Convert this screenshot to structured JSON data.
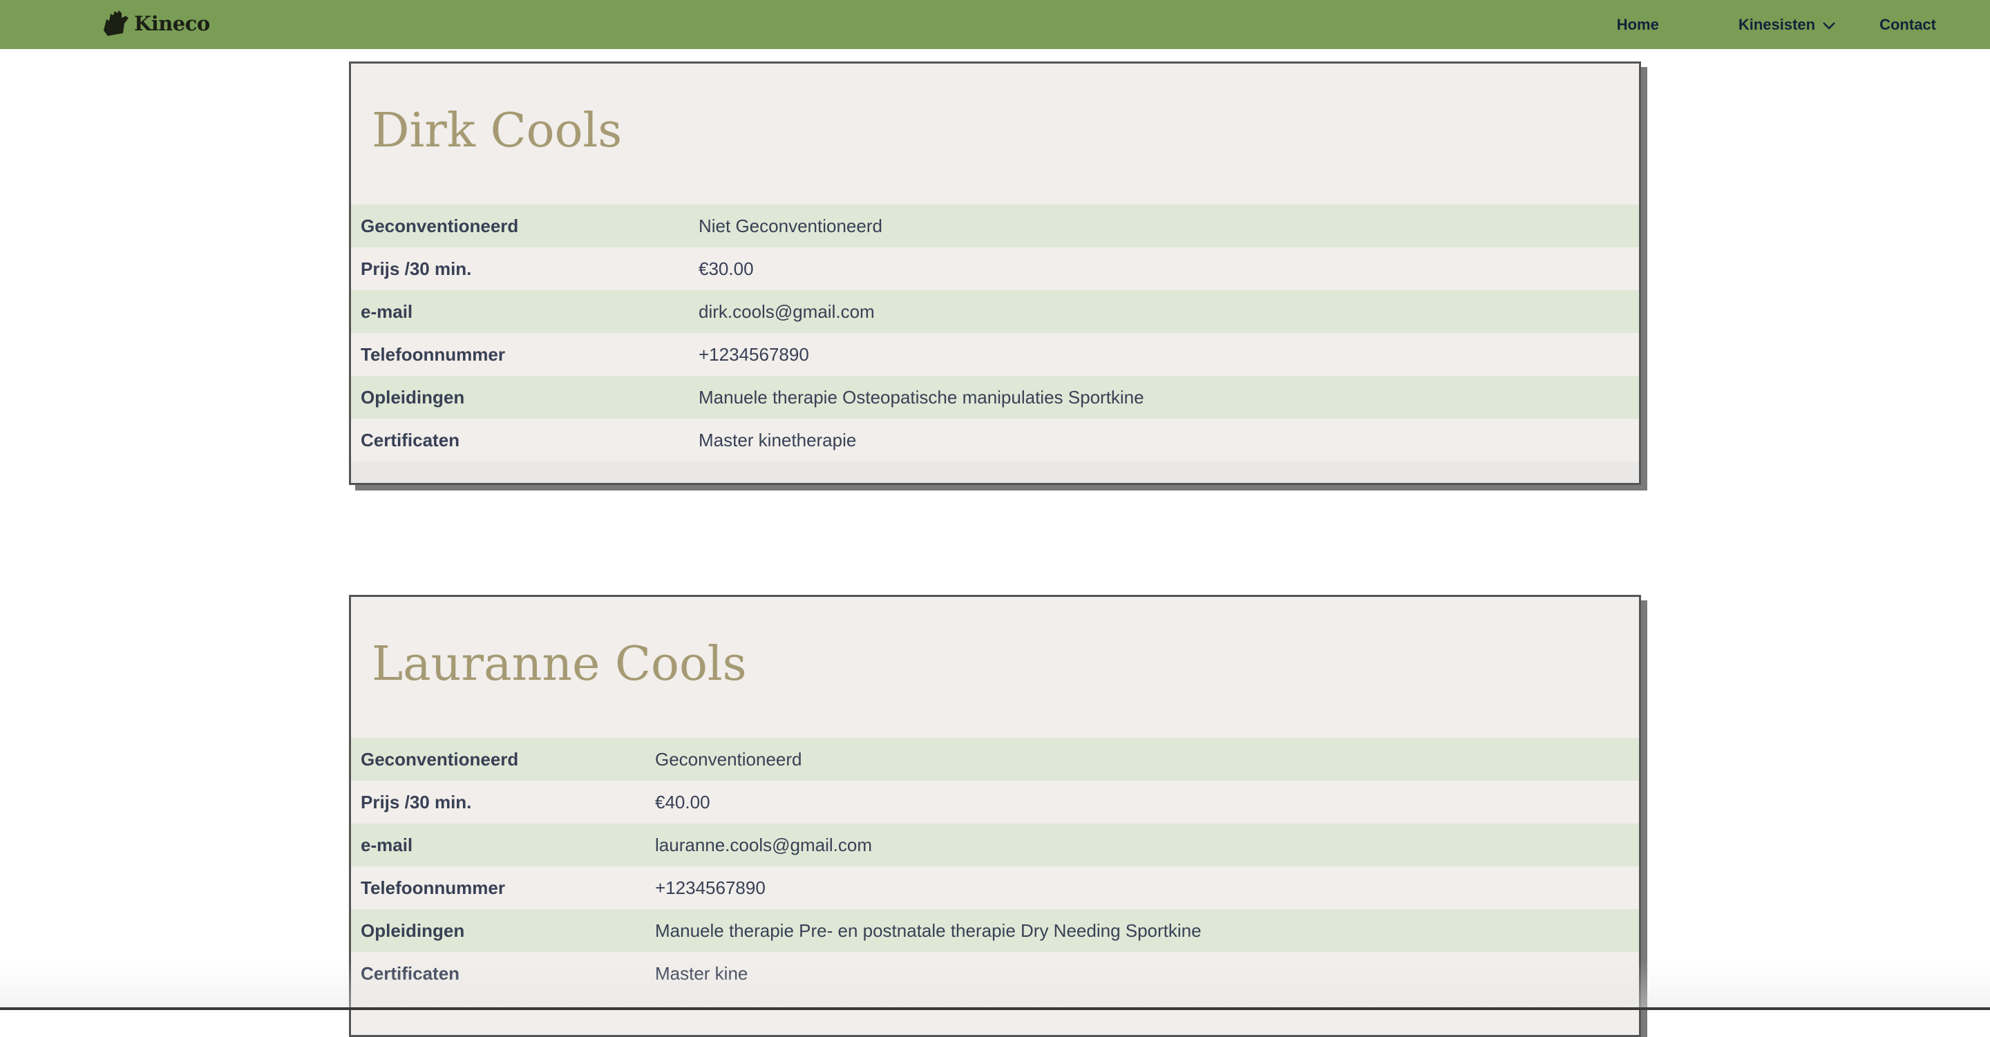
{
  "nav": {
    "brand": "Kineco",
    "links": {
      "home": "Home",
      "kinesisten": "Kinesisten",
      "contact": "Contact"
    }
  },
  "labels": {
    "geconventioneerd": "Geconventioneerd",
    "prijs": "Prijs /30 min.",
    "email": "e-mail",
    "telefoon": "Telefoonnummer",
    "opleidingen": "Opleidingen",
    "certificaten": "Certificaten"
  },
  "profiles": [
    {
      "name": "Dirk Cools",
      "geconventioneerd": "Niet Geconventioneerd",
      "prijs": "€30.00",
      "email": "dirk.cools@gmail.com",
      "telefoon": "+1234567890",
      "opleidingen": "Manuele therapie Osteopatische manipulaties Sportkine",
      "certificaten": "Master kinetherapie"
    },
    {
      "name": "Lauranne Cools",
      "geconventioneerd": "Geconventioneerd",
      "prijs": "€40.00",
      "email": "lauranne.cools@gmail.com",
      "telefoon": "+1234567890",
      "opleidingen": "Manuele therapie Pre- en postnatale therapie Dry Needing Sportkine",
      "certificaten": "Master kine"
    }
  ],
  "colors": {
    "navbar": "#799d55",
    "card_bg": "#f1eeeb",
    "row_shade": "#dfe8d6",
    "title": "#a59a73",
    "text": "#384055"
  }
}
